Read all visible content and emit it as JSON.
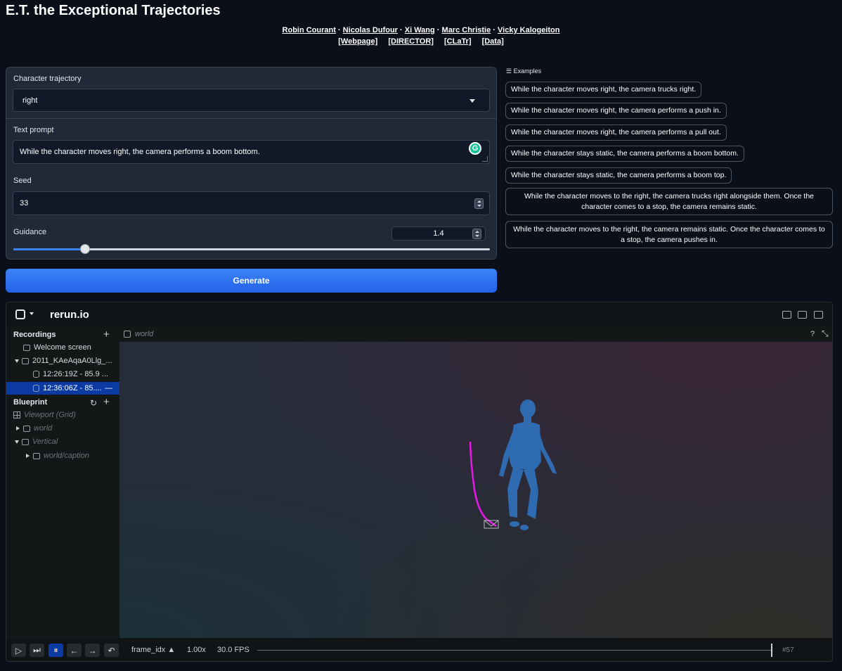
{
  "title": "E.T. the Exceptional Trajectories",
  "authors": [
    "Robin Courant",
    "Nicolas Dufour",
    "Xi Wang",
    "Marc Christie",
    "Vicky Kalogeiton"
  ],
  "author_sep": "·",
  "links": [
    "[Webpage]",
    "[DIRECTOR]",
    "[CLaTr]",
    "[Data]"
  ],
  "form": {
    "trajectory_label": "Character trajectory",
    "trajectory_value": "right",
    "prompt_label": "Text prompt",
    "prompt_value": "While the character moves right, the camera performs a boom bottom.",
    "seed_label": "Seed",
    "seed_value": "33",
    "guidance_label": "Guidance",
    "guidance_value": "1.4",
    "guidance_fraction": 0.15,
    "generate_label": "Generate"
  },
  "examples": {
    "label": "Examples",
    "items": [
      "While the character moves right, the camera trucks right.",
      "While the character moves right, the camera performs a push in.",
      "While the character moves right, the camera performs a pull out.",
      "While the character stays static, the camera performs a boom bottom.",
      "While the character stays static, the camera performs a boom top.",
      "While the character moves to the right, the camera trucks right alongside them. Once the character comes to a stop, the camera remains static.",
      "While the character moves to the right, the camera remains static. Once the character comes to a stop, the camera pushes in."
    ]
  },
  "rerun": {
    "name": "rerun.io",
    "recordings_label": "Recordings",
    "recordings": {
      "welcome": "Welcome screen",
      "app": "2011_KAeAqaA0Llg_...",
      "rec1": "12:26:19Z - 85.9 ...",
      "rec2": "12:36:06Z - 85....",
      "rec2_suffix": "—"
    },
    "blueprint_label": "Blueprint",
    "blueprint": {
      "viewport": "Viewport (Grid)",
      "world": "world",
      "vertical": "Vertical",
      "caption": "world/caption"
    },
    "view_tab": "world",
    "help": "?",
    "timeline": {
      "timeline_name": "frame_idx",
      "speed": "1.00x",
      "fps": "30.0 FPS",
      "frame": "#57",
      "position_fraction": 1.0
    }
  },
  "colors": {
    "accent": "#3b82f6",
    "selected": "#0b3aa3",
    "character": "#2f6bb0",
    "trajectory": "#e619e6"
  }
}
